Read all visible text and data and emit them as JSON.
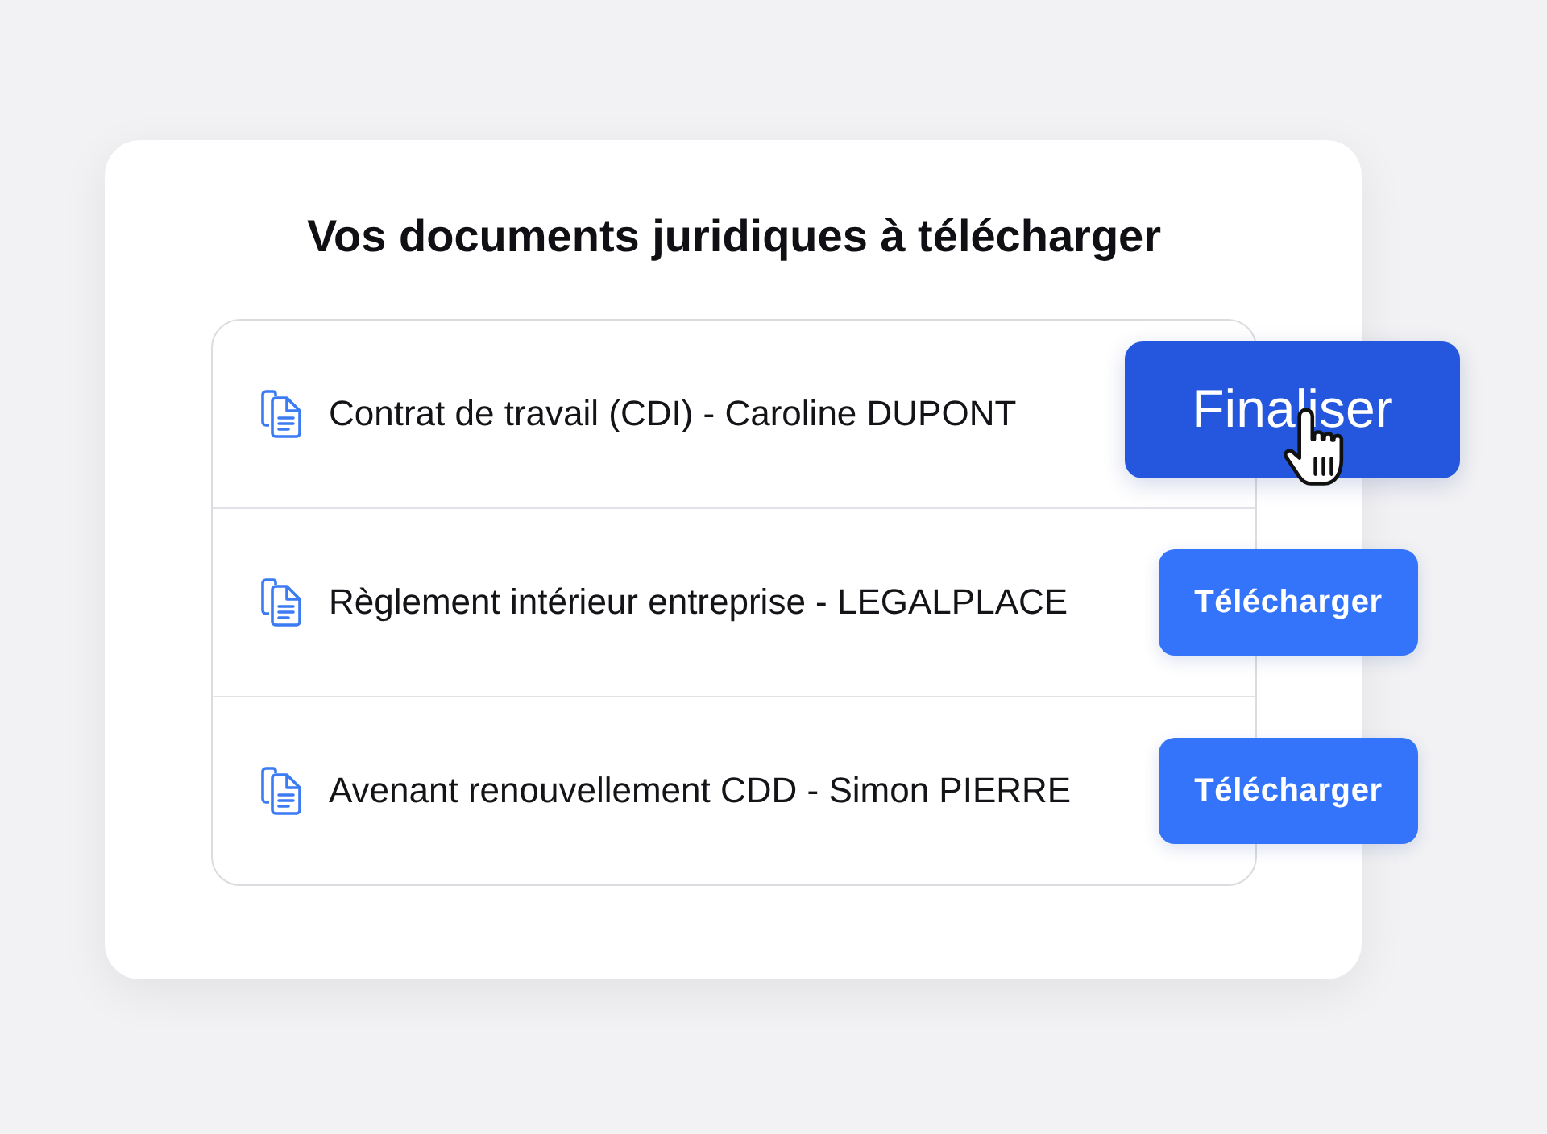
{
  "card": {
    "title": "Vos documents juridiques à télécharger"
  },
  "documents": [
    {
      "name": "Contrat de travail (CDI) - Caroline DUPONT",
      "action": {
        "label": "Finaliser",
        "kind": "highlight",
        "hovered": true
      }
    },
    {
      "name": "Règlement intérieur entreprise - LEGALPLACE",
      "action": {
        "label": "Télécharger",
        "kind": "standard",
        "hovered": false
      }
    },
    {
      "name": "Avenant renouvellement CDD - Simon PIERRE",
      "action": {
        "label": "Télécharger",
        "kind": "standard",
        "hovered": false
      }
    }
  ]
}
